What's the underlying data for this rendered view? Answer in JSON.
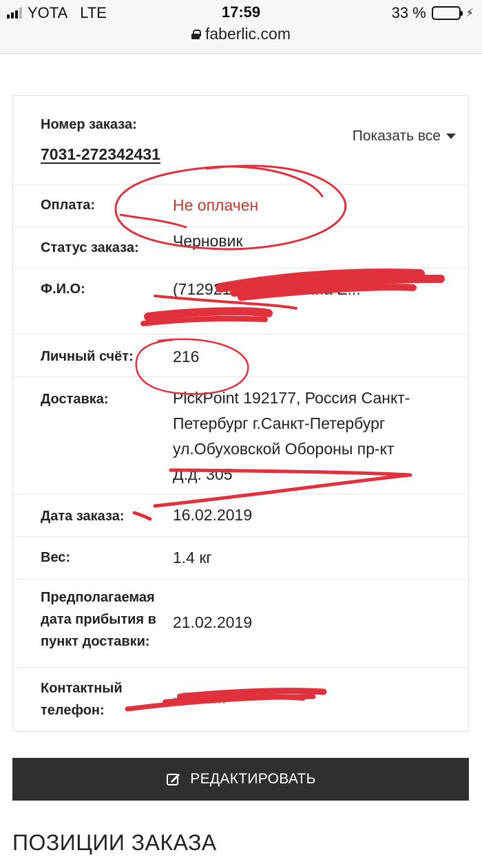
{
  "status_bar": {
    "carrier": "YOTA",
    "network": "LTE",
    "time": "17:59",
    "battery_percent": "33 %",
    "battery_level": 0.33
  },
  "browser": {
    "url": "faberlic.com"
  },
  "order": {
    "number_label": "Номер заказа:",
    "number_value": "7031-272342431",
    "show_all_label": "Показать все",
    "rows": {
      "payment": {
        "label": "Оплата:",
        "value": "Не оплачен"
      },
      "status": {
        "label": "Статус заказа:",
        "value": "Черновик"
      },
      "fio": {
        "label": "Ф.И.О:",
        "value": "(7129210 ... Алёнкина Е..."
      },
      "account": {
        "label": "Личный счёт:",
        "value": "216"
      },
      "delivery": {
        "label": "Доставка:",
        "value": "PickPoint 192177, Россия Санкт-Петербург г.Санкт-Петербург ул.Обуховской Обороны пр-кт Д.д. 305"
      },
      "order_date": {
        "label": "Дата заказа:",
        "value": "16.02.2019"
      },
      "weight": {
        "label": "Вес:",
        "value": "1.4 кг"
      },
      "arrival": {
        "label": "Предполагаемая дата прибытия в пункт доставки:",
        "value": "21.02.2019"
      },
      "phone": {
        "label": "Контактный телефон:",
        "value": "+7 92..."
      }
    }
  },
  "edit_button_label": "РЕДАКТИРОВАТЬ",
  "section_title": "ПОЗИЦИИ ЗАКАЗА",
  "colors": {
    "unpaid": "#c0392b",
    "button_bg": "#2f2f2f",
    "scribble": "#e0313d"
  }
}
